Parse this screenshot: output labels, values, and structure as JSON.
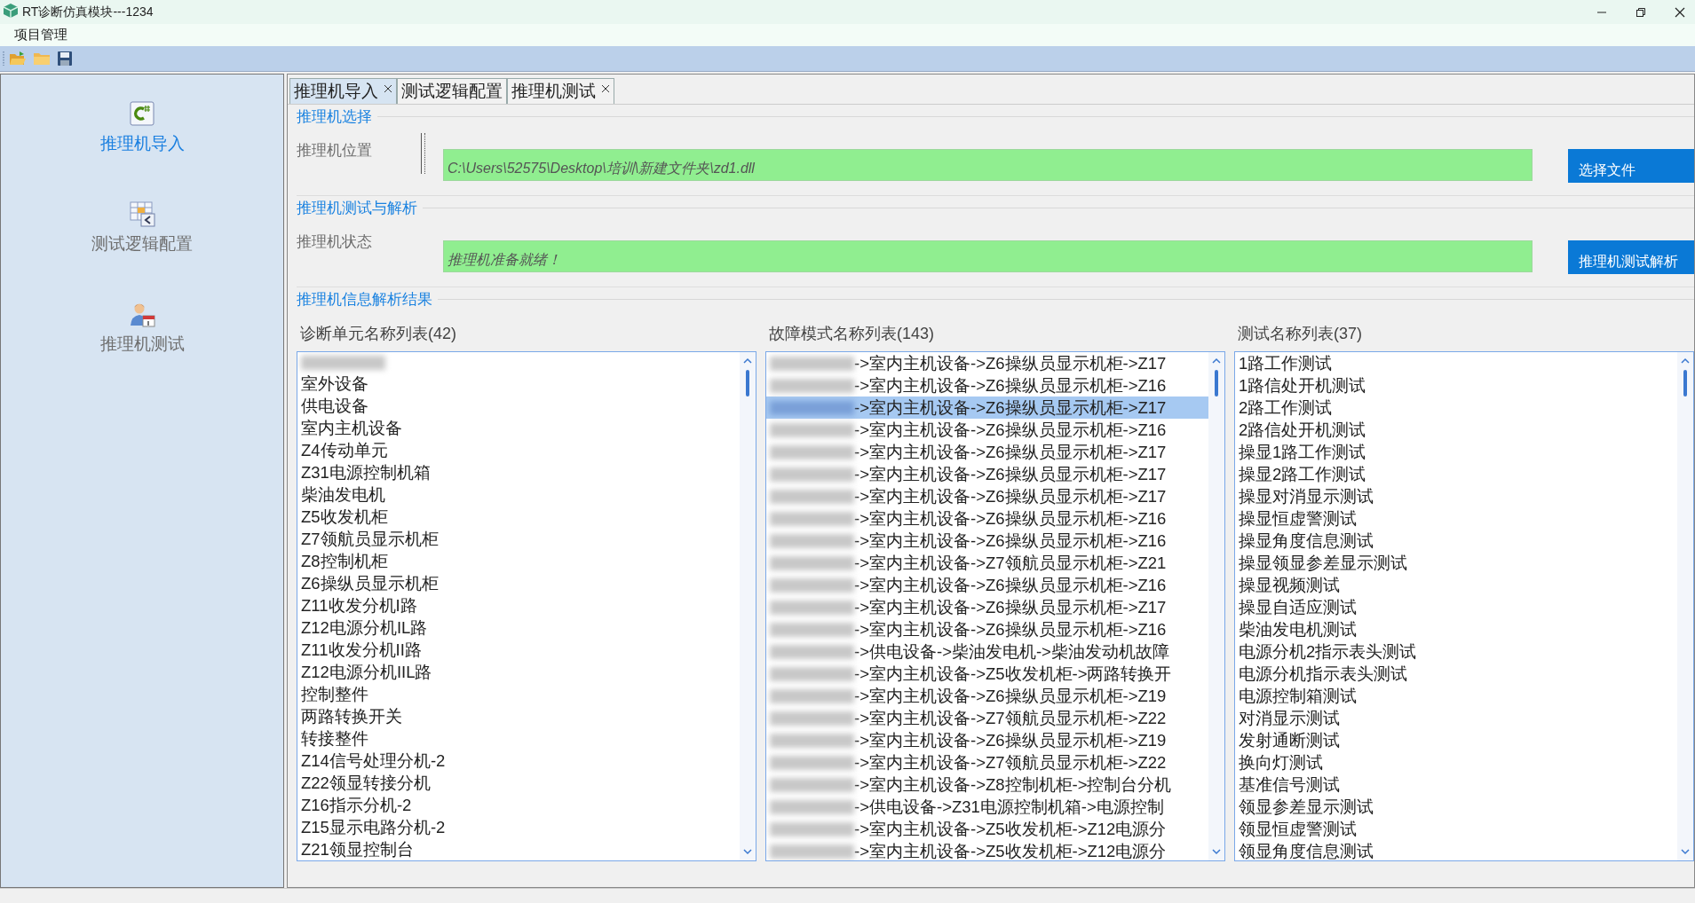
{
  "window": {
    "title": "RT诊断仿真模块---1234"
  },
  "menu": [
    {
      "label": "项目管理"
    }
  ],
  "sidebar": {
    "items": [
      {
        "label": "推理机导入",
        "kind": "csharp",
        "selected": true
      },
      {
        "label": "测试逻辑配置",
        "kind": "table",
        "selected": false
      },
      {
        "label": "推理机测试",
        "kind": "person",
        "selected": false
      }
    ]
  },
  "tabs": [
    {
      "label": "推理机导入",
      "selected": true,
      "closable": true
    },
    {
      "label": "测试逻辑配置",
      "selected": false,
      "closable": false
    },
    {
      "label": "推理机测试",
      "selected": false,
      "closable": true
    }
  ],
  "sections": [
    {
      "title": "推理机选择",
      "field_label": "推理机位置",
      "value": "C:\\Users\\52575\\Desktop\\培训\\新建文件夹\\zd1.dll",
      "button": "选择文件"
    },
    {
      "title": "推理机测试与解析",
      "field_label": "推理机状态",
      "value": "推理机准备就绪！",
      "button": "推理机测试解析"
    }
  ],
  "results": {
    "title": "推理机信息解析结果",
    "lists": [
      {
        "heading": "诊断单元名称列表(42)",
        "items": [
          {
            "redacted": true,
            "selected": false
          },
          {
            "text": "室外设备",
            "redacted": false,
            "selected": false
          },
          {
            "text": "供电设备",
            "redacted": false,
            "selected": false
          },
          {
            "text": "室内主机设备",
            "redacted": false,
            "selected": false
          },
          {
            "text": "Z4传动单元",
            "redacted": false,
            "selected": false
          },
          {
            "text": "Z31电源控制机箱",
            "redacted": false,
            "selected": false
          },
          {
            "text": "柴油发电机",
            "redacted": false,
            "selected": false
          },
          {
            "text": "Z5收发机柜",
            "redacted": false,
            "selected": false
          },
          {
            "text": "Z7领航员显示机柜",
            "redacted": false,
            "selected": false
          },
          {
            "text": "Z8控制机柜",
            "redacted": false,
            "selected": false
          },
          {
            "text": "Z6操纵员显示机柜",
            "redacted": false,
            "selected": false
          },
          {
            "text": "Z11收发分机I路",
            "redacted": false,
            "selected": false
          },
          {
            "text": "Z12电源分机IL路",
            "redacted": false,
            "selected": false
          },
          {
            "text": "Z11收发分机II路",
            "redacted": false,
            "selected": false
          },
          {
            "text": "Z12电源分机IIL路",
            "redacted": false,
            "selected": false
          },
          {
            "text": "控制整件",
            "redacted": false,
            "selected": false
          },
          {
            "text": "两路转换开关",
            "redacted": false,
            "selected": false
          },
          {
            "text": "转接整件",
            "redacted": false,
            "selected": false
          },
          {
            "text": "Z14信号处理分机-2",
            "redacted": false,
            "selected": false
          },
          {
            "text": "Z22领显转接分机",
            "redacted": false,
            "selected": false
          },
          {
            "text": "Z16指示分机-2",
            "redacted": false,
            "selected": false
          },
          {
            "text": "Z15显示电路分机-2",
            "redacted": false,
            "selected": false
          },
          {
            "text": "Z21领显控制台",
            "redacted": false,
            "selected": false
          }
        ]
      },
      {
        "heading": "故障模式名称列表(143)",
        "items": [
          {
            "text": "->室内主机设备->Z6操纵员显示机柜->Z17",
            "redacted": true,
            "selected": false
          },
          {
            "text": "->室内主机设备->Z6操纵员显示机柜->Z16",
            "redacted": true,
            "selected": false
          },
          {
            "text": "->室内主机设备->Z6操纵员显示机柜->Z17",
            "redacted": true,
            "selected": true
          },
          {
            "text": "->室内主机设备->Z6操纵员显示机柜->Z16",
            "redacted": true,
            "selected": false
          },
          {
            "text": "->室内主机设备->Z6操纵员显示机柜->Z17",
            "redacted": true,
            "selected": false
          },
          {
            "text": "->室内主机设备->Z6操纵员显示机柜->Z17",
            "redacted": true,
            "selected": false
          },
          {
            "text": "->室内主机设备->Z6操纵员显示机柜->Z17",
            "redacted": true,
            "selected": false
          },
          {
            "text": "->室内主机设备->Z6操纵员显示机柜->Z16",
            "redacted": true,
            "selected": false
          },
          {
            "text": "->室内主机设备->Z6操纵员显示机柜->Z16",
            "redacted": true,
            "selected": false
          },
          {
            "text": "->室内主机设备->Z7领航员显示机柜->Z21",
            "redacted": true,
            "selected": false
          },
          {
            "text": "->室内主机设备->Z6操纵员显示机柜->Z16",
            "redacted": true,
            "selected": false
          },
          {
            "text": "->室内主机设备->Z6操纵员显示机柜->Z17",
            "redacted": true,
            "selected": false
          },
          {
            "text": "->室内主机设备->Z6操纵员显示机柜->Z16",
            "redacted": true,
            "selected": false
          },
          {
            "text": "->供电设备->柴油发电机->柴油发动机故障",
            "redacted": true,
            "selected": false
          },
          {
            "text": "->室内主机设备->Z5收发机柜->两路转换开",
            "redacted": true,
            "selected": false
          },
          {
            "text": "->室内主机设备->Z6操纵员显示机柜->Z19",
            "redacted": true,
            "selected": false
          },
          {
            "text": "->室内主机设备->Z7领航员显示机柜->Z22",
            "redacted": true,
            "selected": false
          },
          {
            "text": "->室内主机设备->Z6操纵员显示机柜->Z19",
            "redacted": true,
            "selected": false
          },
          {
            "text": "->室内主机设备->Z7领航员显示机柜->Z22",
            "redacted": true,
            "selected": false
          },
          {
            "text": "->室内主机设备->Z8控制机柜->控制台分机",
            "redacted": true,
            "selected": false
          },
          {
            "text": "->供电设备->Z31电源控制机箱->电源控制",
            "redacted": true,
            "selected": false
          },
          {
            "text": "->室内主机设备->Z5收发机柜->Z12电源分",
            "redacted": true,
            "selected": false
          },
          {
            "text": "->室内主机设备->Z5收发机柜->Z12电源分",
            "redacted": true,
            "selected": false
          }
        ]
      },
      {
        "heading": "测试名称列表(37)",
        "items": [
          {
            "text": "1路工作测试",
            "selected": false
          },
          {
            "text": "1路信处开机测试",
            "selected": false
          },
          {
            "text": "2路工作测试",
            "selected": false
          },
          {
            "text": "2路信处开机测试",
            "selected": false
          },
          {
            "text": "操显1路工作测试",
            "selected": false
          },
          {
            "text": "操显2路工作测试",
            "selected": false
          },
          {
            "text": "操显对消显示测试",
            "selected": false
          },
          {
            "text": "操显恒虚警测试",
            "selected": false
          },
          {
            "text": "操显角度信息测试",
            "selected": false
          },
          {
            "text": "操显领显参差显示测试",
            "selected": false
          },
          {
            "text": "操显视频测试",
            "selected": false
          },
          {
            "text": "操显自适应测试",
            "selected": false
          },
          {
            "text": "柴油发电机测试",
            "selected": false
          },
          {
            "text": "电源分机2指示表头测试",
            "selected": false
          },
          {
            "text": "电源分机指示表头测试",
            "selected": false
          },
          {
            "text": "电源控制箱测试",
            "selected": false
          },
          {
            "text": "对消显示测试",
            "selected": false
          },
          {
            "text": "发射通断测试",
            "selected": false
          },
          {
            "text": "换向灯测试",
            "selected": false
          },
          {
            "text": "基准信号测试",
            "selected": false
          },
          {
            "text": "领显参差显示测试",
            "selected": false
          },
          {
            "text": "领显恒虚警测试",
            "selected": false
          },
          {
            "text": "领显角度信息测试",
            "selected": false
          }
        ]
      }
    ]
  }
}
